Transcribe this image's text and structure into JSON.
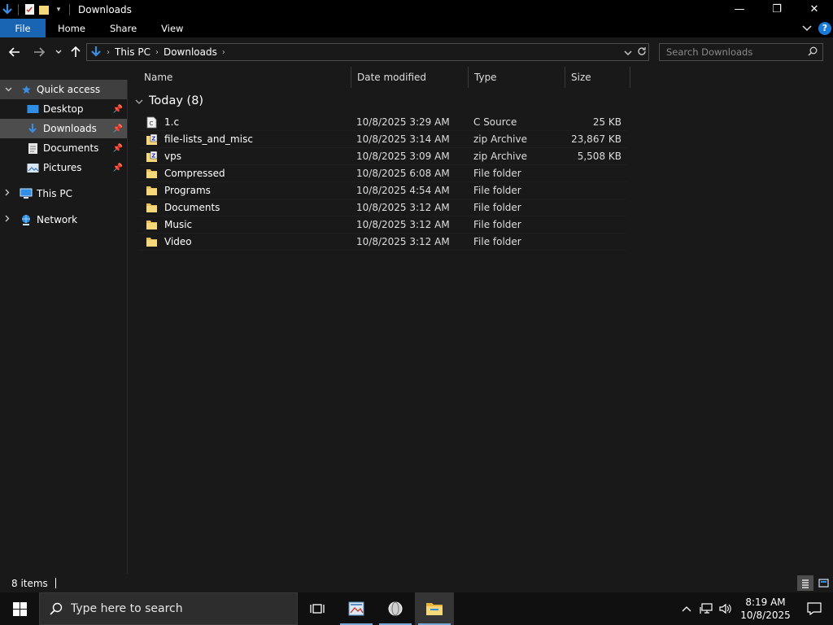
{
  "window": {
    "title": "Downloads",
    "controls": {
      "minimize": "—",
      "restore": "❐",
      "close": "✕"
    }
  },
  "ribbon": {
    "tabs": [
      {
        "label": "File"
      },
      {
        "label": "Home"
      },
      {
        "label": "Share"
      },
      {
        "label": "View"
      }
    ],
    "help": "?"
  },
  "address": {
    "crumbs": [
      "This PC",
      "Downloads"
    ],
    "search_placeholder": "Search Downloads"
  },
  "sidebar": {
    "items": [
      {
        "label": "Quick access",
        "icon": "star-icon"
      },
      {
        "label": "Desktop",
        "icon": "desktop-icon"
      },
      {
        "label": "Downloads",
        "icon": "download-arrow-icon"
      },
      {
        "label": "Documents",
        "icon": "document-icon"
      },
      {
        "label": "Pictures",
        "icon": "pictures-icon"
      },
      {
        "label": "This PC",
        "icon": "computer-icon"
      },
      {
        "label": "Network",
        "icon": "network-icon"
      }
    ]
  },
  "columns": {
    "name": "Name",
    "date": "Date modified",
    "type": "Type",
    "size": "Size"
  },
  "group": {
    "label": "Today (8)"
  },
  "files": [
    {
      "name": "1.c",
      "date": "10/8/2025 3:29 AM",
      "type": "C Source",
      "size": "25 KB",
      "icon": "c-file-icon"
    },
    {
      "name": "file-lists_and_misc",
      "date": "10/8/2025 3:14 AM",
      "type": "zip Archive",
      "size": "23,867 KB",
      "icon": "zip-icon"
    },
    {
      "name": "vps",
      "date": "10/8/2025 3:09 AM",
      "type": "zip Archive",
      "size": "5,508 KB",
      "icon": "zip-icon"
    },
    {
      "name": "Compressed",
      "date": "10/8/2025 6:08 AM",
      "type": "File folder",
      "size": "",
      "icon": "folder-icon"
    },
    {
      "name": "Programs",
      "date": "10/8/2025 4:54 AM",
      "type": "File folder",
      "size": "",
      "icon": "folder-icon"
    },
    {
      "name": "Documents",
      "date": "10/8/2025 3:12 AM",
      "type": "File folder",
      "size": "",
      "icon": "folder-icon"
    },
    {
      "name": "Music",
      "date": "10/8/2025 3:12 AM",
      "type": "File folder",
      "size": "",
      "icon": "folder-icon"
    },
    {
      "name": "Video",
      "date": "10/8/2025 3:12 AM",
      "type": "File folder",
      "size": "",
      "icon": "folder-icon"
    }
  ],
  "status": {
    "items_count": "8 items"
  },
  "taskbar": {
    "search_placeholder": "Type here to search",
    "time": "8:19 AM",
    "date": "10/8/2025"
  },
  "colors": {
    "accent": "#1a64b4",
    "background": "#191919",
    "selected": "#4d4d4d",
    "folder": "#e8c15a"
  }
}
